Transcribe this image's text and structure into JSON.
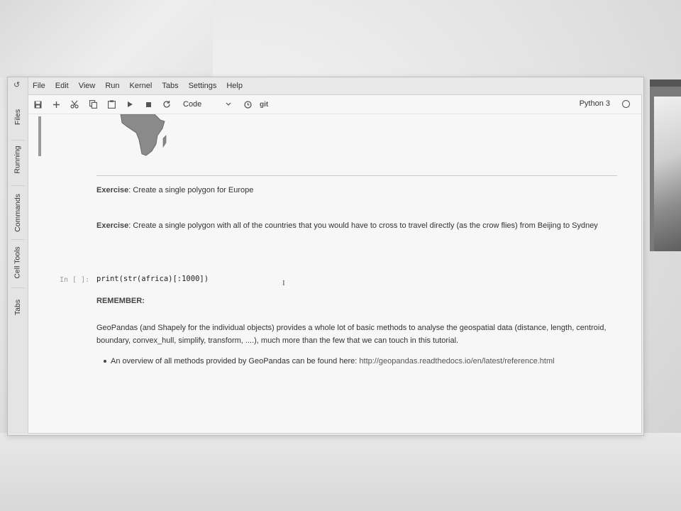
{
  "menu": [
    "File",
    "Edit",
    "View",
    "Run",
    "Kernel",
    "Tabs",
    "Settings",
    "Help"
  ],
  "left_tabs": [
    "Files",
    "Running",
    "Commands",
    "Cell Tools",
    "Tabs"
  ],
  "toolbar": {
    "cell_type": "Code",
    "git_label": "git",
    "kernel": "Python 3"
  },
  "cells": {
    "exercise1_label": "Exercise",
    "exercise1_text": ": Create a single polygon for Europe",
    "exercise2_label": "Exercise",
    "exercise2_text": ": Create a single polygon with all of the countries that you would have to cross to travel directly (as the crow flies) from Beijing to Sydney",
    "code_prompt": "In [ ]:",
    "code_text": "print(str(africa)[:1000])",
    "remember": "REMEMBER:",
    "para_line1": "GeoPandas (and Shapely for the individual objects) provides a whole lot of basic methods to analyse the geospatial data (distance, length, centroid,",
    "para_line2": "boundary, convex_hull, simplify, transform, ....), much more than the few that we can touch in this tutorial.",
    "bullet_text": "An overview of all methods provided by GeoPandas can be found here: ",
    "bullet_link": "http://geopandas.readthedocs.io/en/latest/reference.html"
  }
}
